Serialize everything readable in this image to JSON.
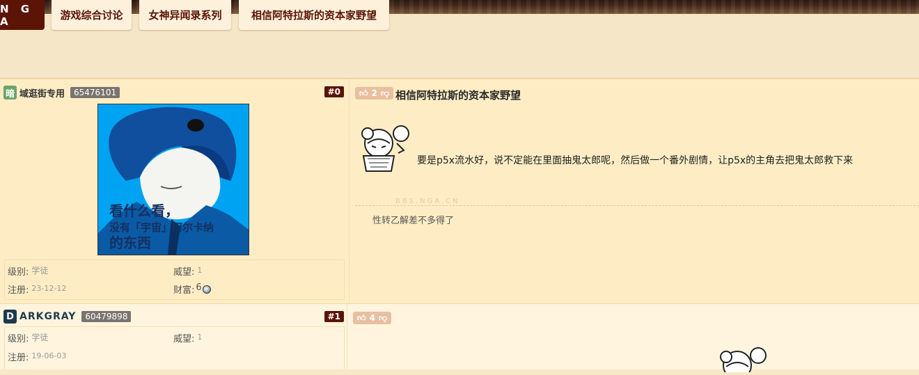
{
  "header": {
    "logo": "N G A",
    "tabs": [
      {
        "label": "游戏综合讨论"
      },
      {
        "label": "女神异闻录系列"
      },
      {
        "label": "相信阿特拉斯的资本家野望"
      }
    ]
  },
  "posts": [
    {
      "avatar_letter": "暗",
      "username": "域逛街专用",
      "uid": "65476101",
      "floor": "#0",
      "avatar_text": [
        "看什么看，",
        "没有「宇宙」阿尔卡纳",
        "的东西"
      ],
      "level_label": "级别:",
      "level": "学徒",
      "prestige_label": "威望:",
      "prestige": "1",
      "reg_label": "注册:",
      "reg_date": "23-12-12",
      "wealth_label": "财富:",
      "wealth": "6",
      "votes": "2",
      "title": "相信阿特拉斯的资本家野望",
      "body": "要是p5x流水好，说不定能在里面抽鬼太郎呢，然后做一个番外剧情，让p5x的主角去把鬼太郎救下来",
      "watermark": "BBS.NGA.CN",
      "signature": "性转乙解差不多得了"
    },
    {
      "avatar_letter": "D",
      "username": "ARKGRAY",
      "uid": "60479898",
      "floor": "#1",
      "level_label": "级别:",
      "level": "学徒",
      "prestige_label": "威望:",
      "prestige": "1",
      "reg_label": "注册:",
      "reg_date": "19-06-03",
      "votes": "4"
    }
  ],
  "colors": {
    "brand": "#5b1406",
    "post_bg_a": "#feedc4",
    "post_bg_b": "#fff5df",
    "avatar_bg": "#00a0f0",
    "vote_bg": "#e8bfa0"
  }
}
